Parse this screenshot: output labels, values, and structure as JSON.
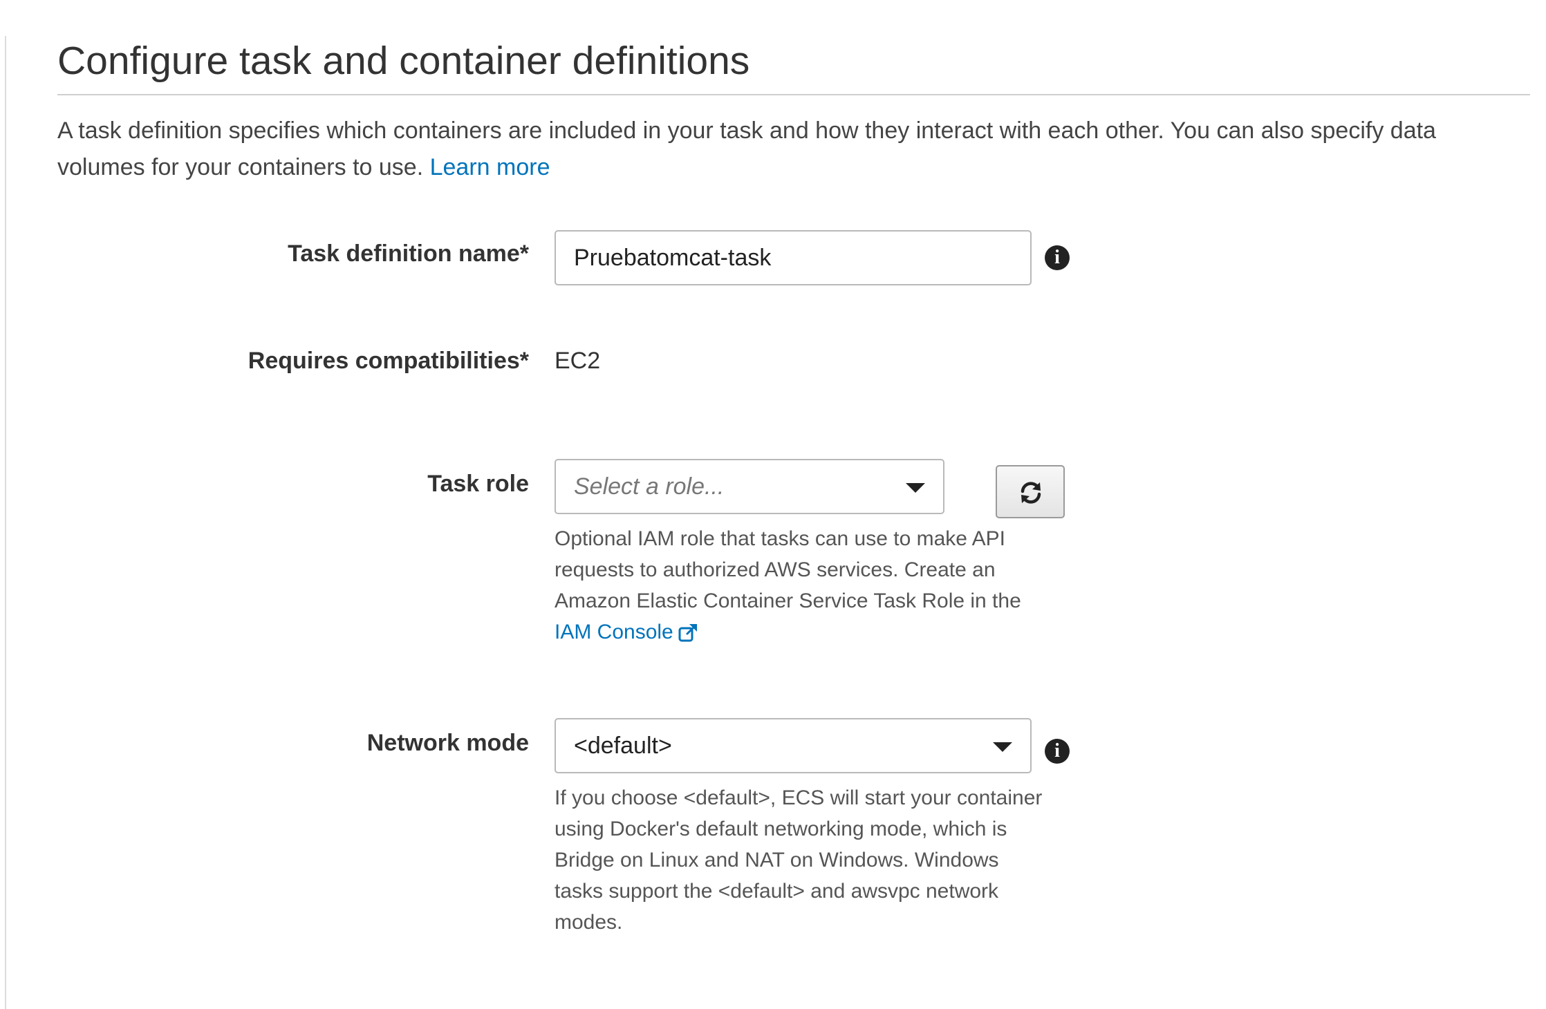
{
  "header": {
    "title": "Configure task and container definitions",
    "intro_text": "A task definition specifies which containers are included in your task and how they interact with each other. You can also specify data volumes for your containers to use.",
    "learn_more_link": "Learn more"
  },
  "form": {
    "task_definition_name": {
      "label": "Task definition name*",
      "value": "Pruebatomcat-task",
      "info_icon": "info-icon"
    },
    "requires_compatibilities": {
      "label": "Requires compatibilities*",
      "value": "EC2"
    },
    "task_role": {
      "label": "Task role",
      "placeholder": "Select a role...",
      "caret_icon": "chevron-down-icon",
      "refresh_icon": "refresh-icon",
      "help_text": "Optional IAM role that tasks can use to make API requests to authorized AWS services. Create an Amazon Elastic Container Service Task Role in the",
      "help_link": "IAM Console",
      "help_link_icon": "external-link-icon"
    },
    "network_mode": {
      "label": "Network mode",
      "value": "<default>",
      "caret_icon": "chevron-down-icon",
      "info_icon": "info-icon",
      "help_text": "If you choose <default>, ECS will start your container using Docker's default networking mode, which is Bridge on Linux and NAT on Windows. Windows tasks support the <default> and awsvpc network modes."
    }
  },
  "colors": {
    "link": "#0073bb",
    "text": "#444444",
    "label": "#333333",
    "border": "#b9b9b9"
  }
}
